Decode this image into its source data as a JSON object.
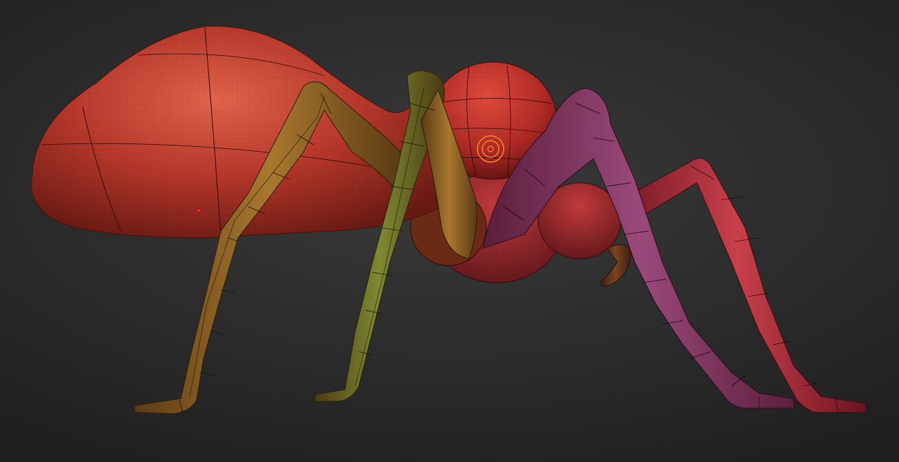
{
  "viewport": {
    "background_color": "#2a2a2a",
    "model": "ant-sculpt",
    "cursor_icon": "brush-cursor-icon"
  },
  "colors": {
    "body_red": "#b8352a",
    "leg_olive": "#8a6a2a",
    "leg_green": "#6e7a2c",
    "leg_purple": "#8a3a6a",
    "leg_red": "#b83040",
    "cursor_orange": "#ff8a1a"
  }
}
